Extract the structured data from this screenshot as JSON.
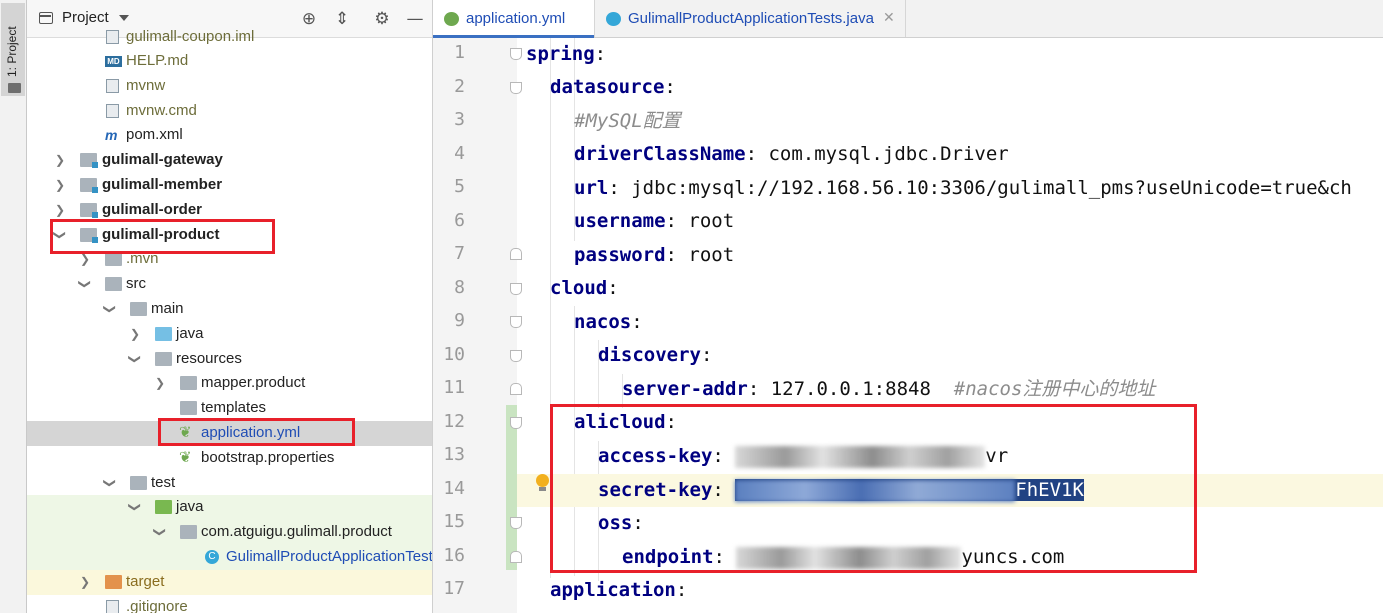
{
  "sidebar_tab": {
    "label": "1: Project"
  },
  "project_panel": {
    "title": "Project",
    "tree": [
      {
        "label": "gulimall-coupon.iml",
        "kind": "file"
      },
      {
        "label": "HELP.md",
        "kind": "md"
      },
      {
        "label": "mvnw",
        "kind": "file"
      },
      {
        "label": "mvnw.cmd",
        "kind": "file"
      },
      {
        "label": "pom.xml",
        "kind": "maven"
      },
      {
        "label": "gulimall-gateway",
        "kind": "module"
      },
      {
        "label": "gulimall-member",
        "kind": "module"
      },
      {
        "label": "gulimall-order",
        "kind": "module"
      },
      {
        "label": "gulimall-product",
        "kind": "module"
      },
      {
        "label": ".mvn",
        "kind": "folder"
      },
      {
        "label": "src",
        "kind": "folder"
      },
      {
        "label": "main",
        "kind": "folder"
      },
      {
        "label": "java",
        "kind": "folder-src"
      },
      {
        "label": "resources",
        "kind": "folder-res"
      },
      {
        "label": "mapper.product",
        "kind": "folder"
      },
      {
        "label": "templates",
        "kind": "folder"
      },
      {
        "label": "application.yml",
        "kind": "spring"
      },
      {
        "label": "bootstrap.properties",
        "kind": "spring"
      },
      {
        "label": "test",
        "kind": "folder"
      },
      {
        "label": "java",
        "kind": "folder-test"
      },
      {
        "label": "com.atguigu.gulimall.product",
        "kind": "package"
      },
      {
        "label": "GulimallProductApplicationTests",
        "kind": "class"
      },
      {
        "label": "target",
        "kind": "folder-excluded"
      },
      {
        "label": ".gitignore",
        "kind": "file"
      }
    ]
  },
  "tabs": [
    {
      "label": "application.yml",
      "active": true
    },
    {
      "label": "GulimallProductApplicationTests.java",
      "active": false
    }
  ],
  "editor": {
    "line_numbers": [
      "1",
      "2",
      "3",
      "4",
      "5",
      "6",
      "7",
      "8",
      "9",
      "10",
      "11",
      "12",
      "13",
      "14",
      "15",
      "16",
      "17"
    ],
    "lines": [
      {
        "key": "spring",
        "sep": ":",
        "value": ""
      },
      {
        "key": "datasource",
        "sep": ":",
        "value": ""
      },
      {
        "comment": "#MySQL配置"
      },
      {
        "key": "driverClassName",
        "sep": ":",
        "value": " com.mysql.jdbc.Driver"
      },
      {
        "key": "url",
        "sep": ":",
        "value": " jdbc:mysql://192.168.56.10:3306/gulimall_pms?useUnicode=true&ch"
      },
      {
        "key": "username",
        "sep": ":",
        "value": " root"
      },
      {
        "key": "password",
        "sep": ":",
        "value": " root"
      },
      {
        "key": "cloud",
        "sep": ":",
        "value": ""
      },
      {
        "key": "nacos",
        "sep": ":",
        "value": ""
      },
      {
        "key": "discovery",
        "sep": ":",
        "value": ""
      },
      {
        "key": "server-addr",
        "sep": ":",
        "value": " 127.0.0.1:8848  ",
        "comment": "#nacos注册中心的地址"
      },
      {
        "key": "alicloud",
        "sep": ":",
        "value": ""
      },
      {
        "key": "access-key",
        "sep": ":",
        "value_tail": "vr"
      },
      {
        "key": "secret-key",
        "sep": ":",
        "value_tail": "FhEV1K"
      },
      {
        "key": "oss",
        "sep": ":",
        "value": ""
      },
      {
        "key": "endpoint",
        "sep": ":",
        "value_tail": "yuncs.com"
      },
      {
        "key": "application",
        "sep": ":",
        "value": ""
      }
    ]
  }
}
